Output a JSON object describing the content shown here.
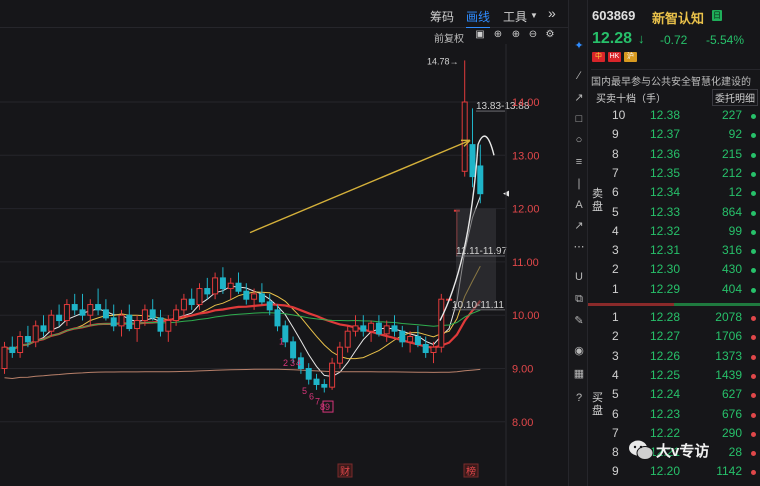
{
  "toolbar": {
    "tab_chips": "筹码",
    "tab_draw": "画线",
    "tab_tools": "工具",
    "tools_arrow": "▼",
    "expand": "»"
  },
  "subtoolbar": {
    "adjust_label": "前复权"
  },
  "chart": {
    "price_axis": [
      "14.00",
      "13.00",
      "12.00",
      "11.00",
      "10.00",
      "9.00",
      "8.00"
    ],
    "annotations": {
      "high_label": "14.78",
      "range1": "13.83-13.88",
      "range2": "11.11-11.97",
      "range3": "10.10-11.11"
    },
    "sequence_markers": [
      "1",
      "2",
      "3",
      "4",
      "5",
      "6",
      "7",
      "8",
      "9"
    ],
    "bottom_tags": {
      "earnings": "财",
      "board": "榜"
    },
    "colors": {
      "up": "#e23b3b",
      "down": "#1fb4c8",
      "ma_white": "#e8e8e8",
      "ma_yellow": "#e8c04a",
      "ma_red": "#e03a3a",
      "ma_green": "#2fae4f",
      "ma_brown": "#b8806a",
      "arrow": "#d4b03a"
    },
    "candles": [
      [
        9.0,
        9.5,
        8.9,
        9.4
      ],
      [
        9.4,
        9.6,
        9.2,
        9.3
      ],
      [
        9.3,
        9.7,
        9.2,
        9.6
      ],
      [
        9.6,
        9.8,
        9.4,
        9.5
      ],
      [
        9.5,
        9.9,
        9.4,
        9.8
      ],
      [
        9.8,
        10.0,
        9.6,
        9.7
      ],
      [
        9.7,
        10.1,
        9.6,
        10.0
      ],
      [
        10.0,
        10.2,
        9.8,
        9.9
      ],
      [
        9.9,
        10.3,
        9.8,
        10.2
      ],
      [
        10.2,
        10.4,
        10.0,
        10.1
      ],
      [
        10.1,
        10.4,
        9.9,
        10.0
      ],
      [
        10.0,
        10.3,
        9.8,
        10.2
      ],
      [
        10.2,
        10.5,
        10.0,
        10.1
      ],
      [
        10.1,
        10.3,
        9.9,
        9.95
      ],
      [
        9.95,
        10.2,
        9.7,
        9.8
      ],
      [
        9.8,
        10.1,
        9.6,
        10.0
      ],
      [
        10.0,
        10.2,
        9.7,
        9.75
      ],
      [
        9.75,
        10.0,
        9.5,
        9.9
      ],
      [
        9.9,
        10.2,
        9.8,
        10.1
      ],
      [
        10.1,
        10.3,
        9.9,
        9.95
      ],
      [
        9.95,
        10.1,
        9.6,
        9.7
      ],
      [
        9.7,
        10.0,
        9.5,
        9.9
      ],
      [
        9.9,
        10.2,
        9.8,
        10.1
      ],
      [
        10.1,
        10.4,
        10.0,
        10.3
      ],
      [
        10.3,
        10.5,
        10.1,
        10.2
      ],
      [
        10.2,
        10.6,
        10.1,
        10.5
      ],
      [
        10.5,
        10.7,
        10.3,
        10.4
      ],
      [
        10.4,
        10.8,
        10.3,
        10.7
      ],
      [
        10.7,
        10.9,
        10.4,
        10.5
      ],
      [
        10.5,
        10.7,
        10.3,
        10.6
      ],
      [
        10.6,
        10.8,
        10.4,
        10.45
      ],
      [
        10.45,
        10.6,
        10.2,
        10.3
      ],
      [
        10.3,
        10.5,
        10.1,
        10.4
      ],
      [
        10.4,
        10.6,
        10.2,
        10.25
      ],
      [
        10.25,
        10.4,
        10.0,
        10.1
      ],
      [
        10.1,
        10.2,
        9.7,
        9.8
      ],
      [
        9.8,
        9.9,
        9.4,
        9.5
      ],
      [
        9.5,
        9.6,
        9.1,
        9.2
      ],
      [
        9.2,
        9.3,
        8.9,
        9.0
      ],
      [
        9.0,
        9.1,
        8.7,
        8.8
      ],
      [
        8.8,
        8.9,
        8.6,
        8.7
      ],
      [
        8.7,
        8.8,
        8.55,
        8.65
      ],
      [
        8.65,
        9.2,
        8.6,
        9.1
      ],
      [
        9.1,
        9.5,
        9.0,
        9.4
      ],
      [
        9.4,
        9.8,
        9.3,
        9.7
      ],
      [
        9.7,
        10.0,
        9.6,
        9.8
      ],
      [
        9.8,
        10.0,
        9.6,
        9.7
      ],
      [
        9.7,
        9.9,
        9.5,
        9.85
      ],
      [
        9.85,
        10.0,
        9.6,
        9.65
      ],
      [
        9.65,
        9.9,
        9.5,
        9.8
      ],
      [
        9.8,
        10.0,
        9.6,
        9.7
      ],
      [
        9.7,
        9.8,
        9.4,
        9.5
      ],
      [
        9.5,
        9.7,
        9.3,
        9.6
      ],
      [
        9.6,
        9.8,
        9.4,
        9.45
      ],
      [
        9.45,
        9.6,
        9.2,
        9.3
      ],
      [
        9.3,
        9.5,
        9.1,
        9.4
      ],
      [
        9.4,
        10.4,
        9.3,
        10.3
      ],
      [
        10.3,
        10.3,
        10.3,
        10.3
      ],
      [
        11.97,
        11.97,
        11.11,
        11.97
      ],
      [
        12.7,
        14.78,
        12.6,
        14.0
      ],
      [
        13.2,
        13.88,
        12.4,
        12.6
      ],
      [
        12.8,
        13.2,
        12.1,
        12.28
      ]
    ]
  },
  "quote": {
    "code": "603869",
    "name": "新智认知",
    "badge": "日",
    "price": "12.28",
    "arrow": "↓",
    "change": "-0.72",
    "change_pct": "-5.54%",
    "flags": [
      "中",
      "HK",
      "沪"
    ],
    "description": "国内最早参与公共安全智慧化建设的",
    "tab_book": "买卖十档（手）",
    "tab_detail": "委托明细",
    "sell_label": "卖盘",
    "buy_label": "买盘",
    "asks": [
      {
        "level": "10",
        "price": "12.38",
        "vol": "227"
      },
      {
        "level": "9",
        "price": "12.37",
        "vol": "92"
      },
      {
        "level": "8",
        "price": "12.36",
        "vol": "215"
      },
      {
        "level": "7",
        "price": "12.35",
        "vol": "212"
      },
      {
        "level": "6",
        "price": "12.34",
        "vol": "12"
      },
      {
        "level": "5",
        "price": "12.33",
        "vol": "864"
      },
      {
        "level": "4",
        "price": "12.32",
        "vol": "99"
      },
      {
        "level": "3",
        "price": "12.31",
        "vol": "316"
      },
      {
        "level": "2",
        "price": "12.30",
        "vol": "430"
      },
      {
        "level": "1",
        "price": "12.29",
        "vol": "404"
      }
    ],
    "bids": [
      {
        "level": "1",
        "price": "12.28",
        "vol": "2078"
      },
      {
        "level": "2",
        "price": "12.27",
        "vol": "1706"
      },
      {
        "level": "3",
        "price": "12.26",
        "vol": "1373"
      },
      {
        "level": "4",
        "price": "12.25",
        "vol": "1439"
      },
      {
        "level": "5",
        "price": "12.24",
        "vol": "627"
      },
      {
        "level": "6",
        "price": "12.23",
        "vol": "676"
      },
      {
        "level": "7",
        "price": "12.22",
        "vol": "290"
      },
      {
        "level": "8",
        "price": "12.21",
        "vol": "28"
      },
      {
        "level": "9",
        "price": "12.20",
        "vol": "1142"
      }
    ]
  },
  "watermark": {
    "text": "大v专访"
  }
}
